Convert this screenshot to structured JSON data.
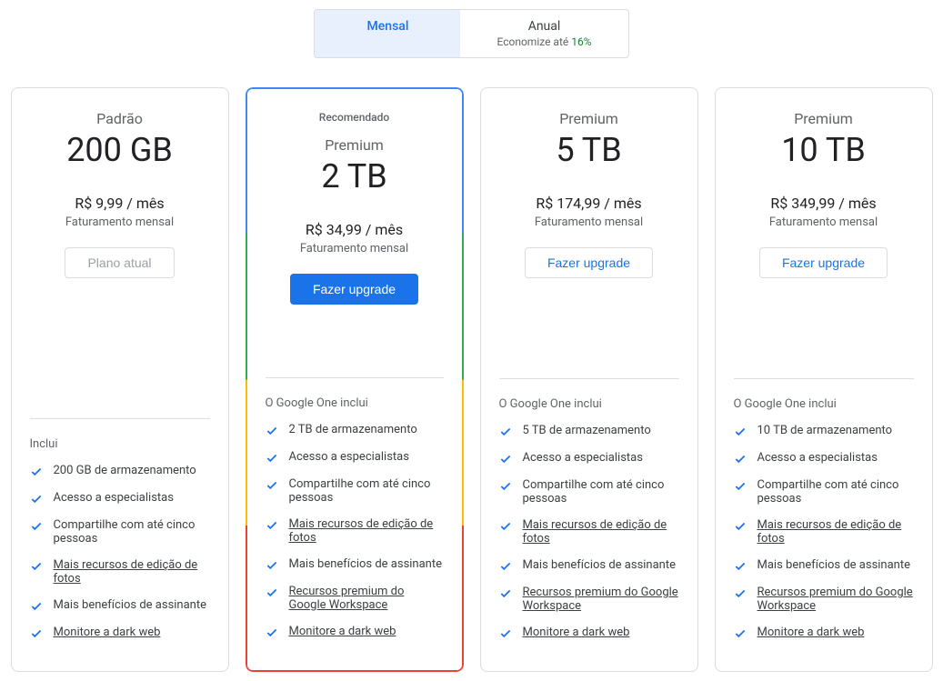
{
  "toggle": {
    "monthly": "Mensal",
    "annual": "Anual",
    "annual_sub_prefix": "Economize até ",
    "annual_sub_pct": "16%"
  },
  "plans": [
    {
      "badge": "",
      "name": "Padrão",
      "size": "200 GB",
      "price": "R$ 9,99 / mês",
      "billing": "Faturamento mensal",
      "button": "Plano atual",
      "button_style": "disabled",
      "recommended": false,
      "features_title": "Inclui",
      "features": [
        {
          "text": "200 GB de armazenamento",
          "link": false
        },
        {
          "text": "Acesso a especialistas",
          "link": false
        },
        {
          "text": "Compartilhe com até cinco pessoas",
          "link": false
        },
        {
          "text": "Mais recursos de edição de fotos",
          "link": true
        },
        {
          "text": "Mais benefícios de assinante",
          "link": false
        },
        {
          "text": "Monitore a dark web",
          "link": true
        }
      ]
    },
    {
      "badge": "Recomendado",
      "name": "Premium",
      "size": "2 TB",
      "price": "R$ 34,99 / mês",
      "billing": "Faturamento mensal",
      "button": "Fazer upgrade",
      "button_style": "primary",
      "recommended": true,
      "features_title": "O Google One inclui",
      "features": [
        {
          "text": "2 TB de armazenamento",
          "link": false
        },
        {
          "text": "Acesso a especialistas",
          "link": false
        },
        {
          "text": "Compartilhe com até cinco pessoas",
          "link": false
        },
        {
          "text": "Mais recursos de edição de fotos",
          "link": true
        },
        {
          "text": "Mais benefícios de assinante",
          "link": false
        },
        {
          "text": "Recursos premium do Google Workspace",
          "link": true
        },
        {
          "text": "Monitore a dark web",
          "link": true
        }
      ]
    },
    {
      "badge": "",
      "name": "Premium",
      "size": "5 TB",
      "price": "R$ 174,99 / mês",
      "billing": "Faturamento mensal",
      "button": "Fazer upgrade",
      "button_style": "outline",
      "recommended": false,
      "features_title": "O Google One inclui",
      "features": [
        {
          "text": "5 TB de armazenamento",
          "link": false
        },
        {
          "text": "Acesso a especialistas",
          "link": false
        },
        {
          "text": "Compartilhe com até cinco pessoas",
          "link": false
        },
        {
          "text": "Mais recursos de edição de fotos",
          "link": true
        },
        {
          "text": "Mais benefícios de assinante",
          "link": false
        },
        {
          "text": "Recursos premium do Google Workspace",
          "link": true
        },
        {
          "text": "Monitore a dark web",
          "link": true
        }
      ]
    },
    {
      "badge": "",
      "name": "Premium",
      "size": "10 TB",
      "price": "R$ 349,99 / mês",
      "billing": "Faturamento mensal",
      "button": "Fazer upgrade",
      "button_style": "outline",
      "recommended": false,
      "features_title": "O Google One inclui",
      "features": [
        {
          "text": "10 TB de armazenamento",
          "link": false
        },
        {
          "text": "Acesso a especialistas",
          "link": false
        },
        {
          "text": "Compartilhe com até cinco pessoas",
          "link": false
        },
        {
          "text": "Mais recursos de edição de fotos",
          "link": true
        },
        {
          "text": "Mais benefícios de assinante",
          "link": false
        },
        {
          "text": "Recursos premium do Google Workspace",
          "link": true
        },
        {
          "text": "Monitore a dark web",
          "link": true
        }
      ]
    }
  ]
}
